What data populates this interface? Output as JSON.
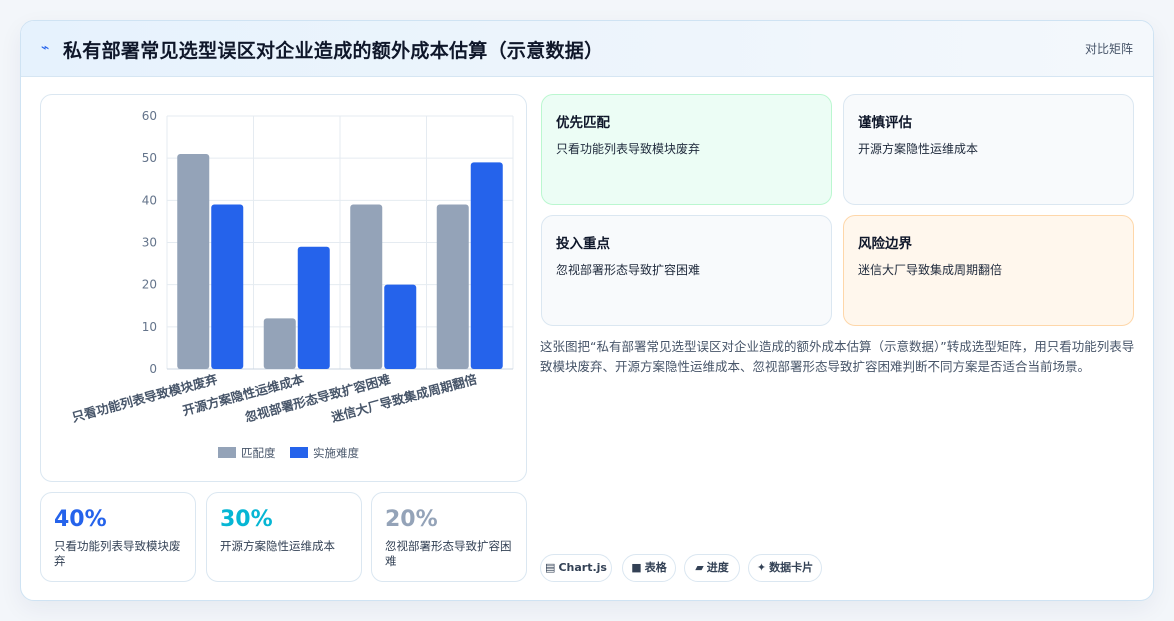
{
  "header": {
    "title": "私有部署常见选型误区对企业造成的额外成本估算（示意数据）",
    "tag": "对比矩阵"
  },
  "chart_data": {
    "type": "bar",
    "categories": [
      "只看功能列表导致模块废弃",
      "开源方案隐性运维成本",
      "忽视部署形态导致扩容困难",
      "迷信大厂导致集成周期翻倍"
    ],
    "series": [
      {
        "name": "匹配度",
        "values": [
          51,
          12,
          39,
          39
        ],
        "color": "#94a3b8"
      },
      {
        "name": "实施难度",
        "values": [
          39,
          29,
          20,
          49
        ],
        "color": "#2563eb"
      }
    ],
    "ylim": [
      0,
      60
    ],
    "yticks": [
      0,
      10,
      20,
      30,
      40,
      50,
      60
    ],
    "grid": true,
    "legend": "bottom"
  },
  "stats": [
    {
      "value": "40%",
      "label": "只看功能列表导致模块废弃",
      "color": "#2563eb"
    },
    {
      "value": "30%",
      "label": "开源方案隐性运维成本",
      "color": "#06b6d4"
    },
    {
      "value": "20%",
      "label": "忽视部署形态导致扩容困难",
      "color": "#94a3b8"
    }
  ],
  "quadrants": [
    {
      "title": "优先匹配",
      "desc": "只看功能列表导致模块废弃",
      "bg": "#ecfdf5",
      "border": "#bbf7d0"
    },
    {
      "title": "谨慎评估",
      "desc": "开源方案隐性运维成本",
      "bg": "#f8fafc",
      "border": "#dbe7f1"
    },
    {
      "title": "投入重点",
      "desc": "忽视部署形态导致扩容困难",
      "bg": "#f8fafc",
      "border": "#dbe7f1"
    },
    {
      "title": "风险边界",
      "desc": "迷信大厂导致集成周期翻倍",
      "bg": "#fff7ed",
      "border": "#fed7aa"
    }
  ],
  "description": "这张图把“私有部署常见选型误区对企业造成的额外成本估算（示意数据）”转成选型矩阵，用只看功能列表导致模块废弃、开源方案隐性运维成本、忽视部署形态导致扩容困难判断不同方案是否适合当前场景。",
  "pills": [
    {
      "icon": "chart-icon",
      "glyph": "▤",
      "label": "Chart.js"
    },
    {
      "icon": "table-icon",
      "glyph": "■",
      "label": "表格"
    },
    {
      "icon": "progress-icon",
      "glyph": "▰",
      "label": "进度"
    },
    {
      "icon": "sparkle-icon",
      "glyph": "✦",
      "label": "数据卡片"
    }
  ]
}
